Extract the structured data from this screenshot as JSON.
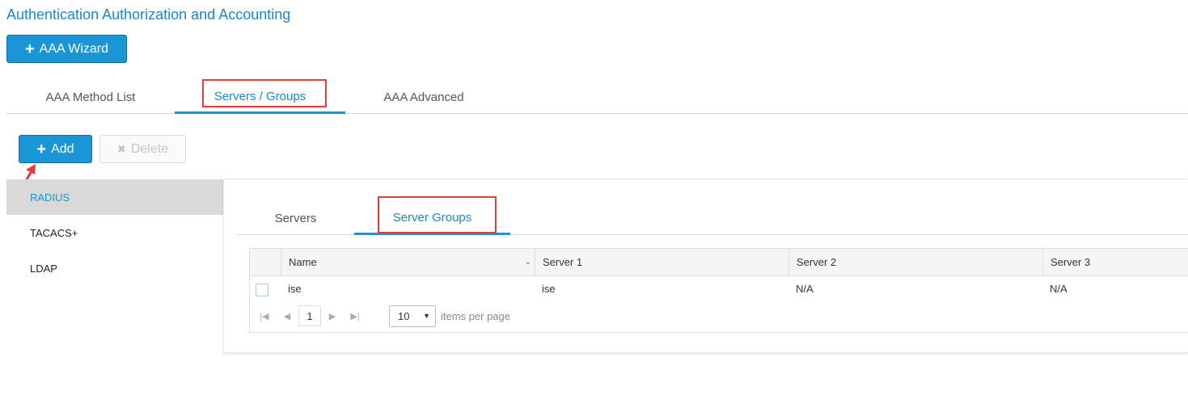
{
  "page": {
    "title": "Authentication Authorization and Accounting"
  },
  "wizard_button": {
    "icon": "plus-icon",
    "label": "AAA Wizard"
  },
  "top_tabs": [
    {
      "label": "AAA Method List",
      "active": false
    },
    {
      "label": "Servers / Groups",
      "active": true
    },
    {
      "label": "AAA Advanced",
      "active": false
    }
  ],
  "toolbar": {
    "add_label": "Add",
    "delete_label": "Delete",
    "delete_disabled": true
  },
  "sidebar": {
    "items": [
      {
        "label": "RADIUS",
        "active": true
      },
      {
        "label": "TACACS+",
        "active": false
      },
      {
        "label": "LDAP",
        "active": false
      }
    ]
  },
  "inner_tabs": [
    {
      "label": "Servers",
      "active": false
    },
    {
      "label": "Server Groups",
      "active": true
    }
  ],
  "table": {
    "columns": [
      "Name",
      "Server 1",
      "Server 2",
      "Server 3"
    ],
    "rows": [
      {
        "name": "ise",
        "server1": "ise",
        "server2": "N/A",
        "server3": "N/A",
        "checked": false
      }
    ]
  },
  "pager": {
    "current_page": "1",
    "page_size": "10",
    "page_size_label": "items per page"
  },
  "colors": {
    "accent": "#1a96d6",
    "highlight_box": "#e03c3c",
    "sidebar_active_bg": "#d9d9d9"
  }
}
